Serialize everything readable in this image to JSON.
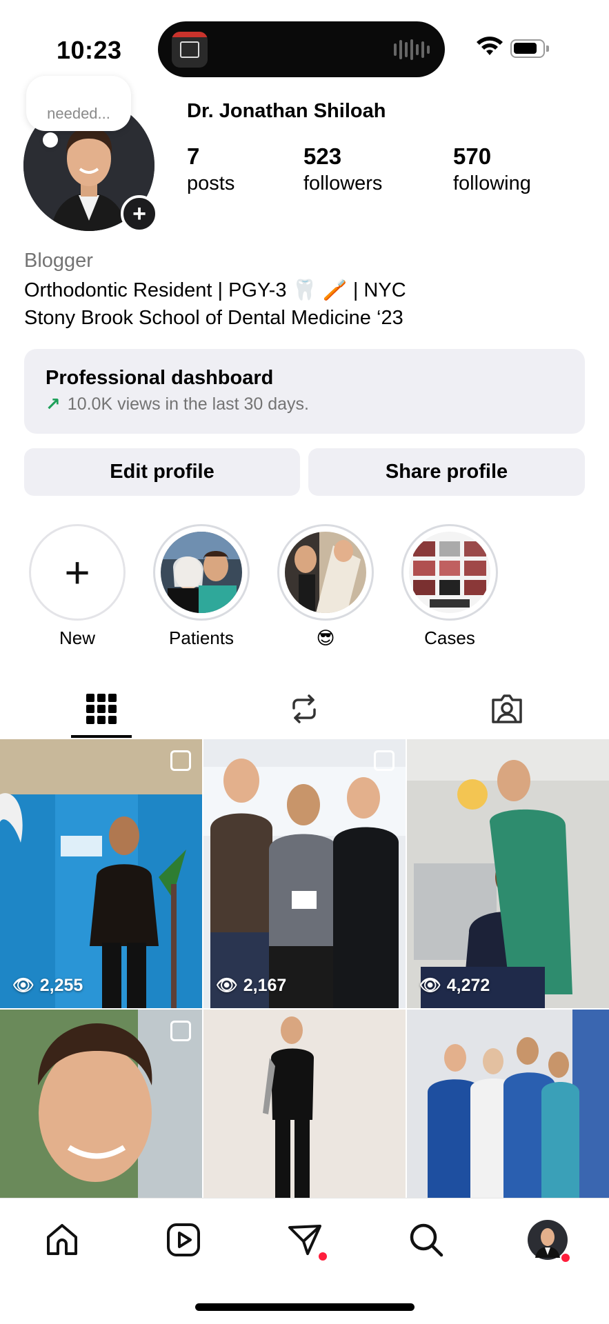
{
  "status": {
    "time": "10:23"
  },
  "profile": {
    "note": "needed...",
    "name": "Dr. Jonathan Shiloah",
    "stats": {
      "posts": {
        "value": "7",
        "label": "posts"
      },
      "followers": {
        "value": "523",
        "label": "followers"
      },
      "following": {
        "value": "570",
        "label": "following"
      }
    },
    "category": "Blogger",
    "bio_line1": "Orthodontic Resident | PGY-3 🦷 🪥 | NYC",
    "bio_line2": "Stony Brook School of Dental Medicine ‘23"
  },
  "dashboard": {
    "title": "Professional dashboard",
    "subtitle": "10.0K views in the last 30 days."
  },
  "buttons": {
    "edit": "Edit profile",
    "share": "Share profile"
  },
  "highlights": [
    {
      "label": "New"
    },
    {
      "label": "Patients"
    },
    {
      "label": "😎"
    },
    {
      "label": "Cases"
    }
  ],
  "tabs": [
    "grid-icon",
    "reposts-icon",
    "tagged-icon"
  ],
  "posts": [
    {
      "views": "2,255",
      "multi": true
    },
    {
      "views": "2,167",
      "multi": true
    },
    {
      "views": "4,272",
      "multi": false
    },
    {
      "views": "",
      "multi": true
    },
    {
      "views": "",
      "multi": false
    },
    {
      "views": "",
      "multi": false
    }
  ],
  "nav": [
    "home-icon",
    "reels-icon",
    "messages-icon",
    "search-icon",
    "profile-avatar"
  ],
  "colors": {
    "accent_green": "#1ea05a",
    "notification_red": "#ff1e3c",
    "button_bg": "#efeff4"
  }
}
